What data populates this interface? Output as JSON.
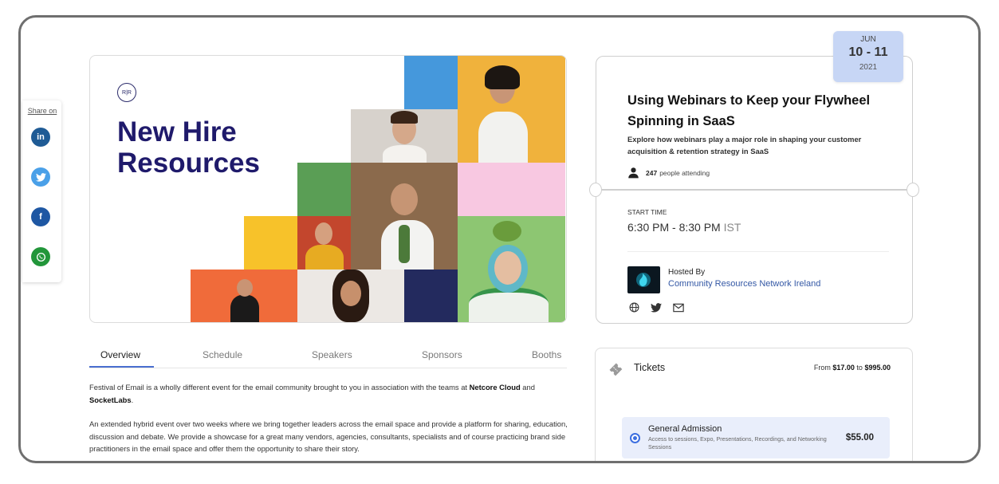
{
  "share": {
    "label": "Share on",
    "buttons": [
      {
        "name": "linkedin",
        "glyph": "in",
        "color": "#1f5b95"
      },
      {
        "name": "twitter",
        "glyph": "t",
        "color": "#4aa0e8"
      },
      {
        "name": "facebook",
        "glyph": "f",
        "color": "#1e57a3"
      },
      {
        "name": "whatsapp",
        "glyph": "w",
        "color": "#22963a"
      }
    ]
  },
  "banner": {
    "logo": "R|R",
    "title_line1": "New Hire",
    "title_line2": "Resources"
  },
  "tabs": [
    "Overview",
    "Schedule",
    "Speakers",
    "Sponsors",
    "Booths"
  ],
  "description": {
    "p1_a": "Festival of Email is a wholly different event for the email community brought to you in association with the teams at ",
    "p1_b": "Netcore Cloud",
    "p1_c": " and ",
    "p1_d": "SocketLabs",
    "p1_e": ".",
    "p2": "An extended hybrid event over two weeks where we bring together leaders across the email space and provide a platform for sharing, education, discussion and debate. We provide a showcase for a great many vendors, agencies, consultants, specialists and of course practicing brand side practitioners in the email space and offer them the opportunity to share their story."
  },
  "event": {
    "date_month": "JUN",
    "date_days": "10 - 11",
    "date_year": "2021",
    "title": "Using Webinars to Keep your Flywheel Spinning in SaaS",
    "subtitle": "Explore how webinars play a major role in shaping your customer acquisition & retention strategy in SaaS",
    "attending_count": "247",
    "attending_label": "people attending",
    "start_label": "START TIME",
    "start_time": "6:30 PM - 8:30 PM",
    "timezone": "IST",
    "hosted_by_label": "Hosted By",
    "host_name": "Community Resources Network Ireland"
  },
  "tickets": {
    "title": "Tickets",
    "range_from_label": "From",
    "range_min": "$17.00",
    "range_to_label": "to",
    "range_max": "$995.00",
    "option": {
      "name": "General Admission",
      "description": "Access to sessions, Expo, Presentations, Recordings, and Networking Sessions",
      "price": "$55.00"
    }
  },
  "colors": {
    "accent": "#4a6fd0",
    "title_navy": "#1f1a6b",
    "date_badge": "#c7d6f5",
    "ticket_option_bg": "#e9eefb"
  }
}
